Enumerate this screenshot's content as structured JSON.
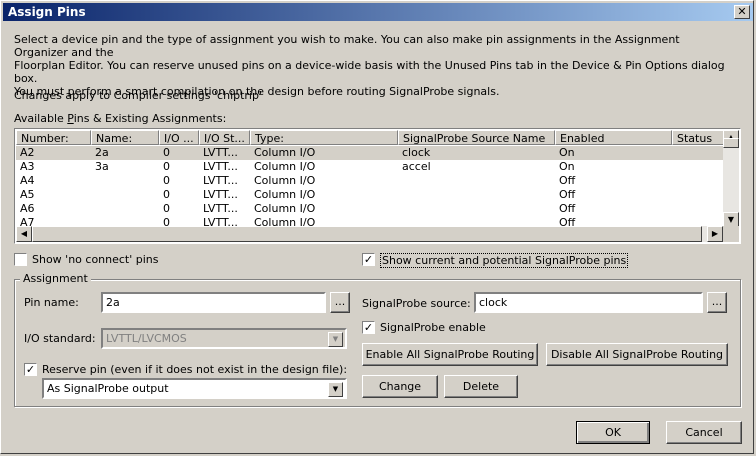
{
  "window": {
    "title": "Assign Pins",
    "close_glyph": "✕"
  },
  "intro": {
    "line1": "Select a device pin and the type of assignment you wish to make.  You can also make pin assignments in the Assignment Organizer and the",
    "line2": "Floorplan Editor.  You can reserve unused pins on a device-wide basis with the Unused Pins tab in the Device & Pin Options dialog box.",
    "line3": "You must perform a smart compilation on the design before routing SignalProbe signals."
  },
  "compiler_note": "Changes apply to Compiler settings 'chiptrip'",
  "list": {
    "label_pre": "Available ",
    "label_u": "P",
    "label_post": "ins & Existing Assignments:",
    "columns": [
      "Number:",
      "Name:",
      "I/O ...",
      "I/O St...",
      "Type:",
      "SignalProbe Source Name",
      "Enabled",
      "Status"
    ],
    "rows": [
      [
        "A2",
        "2a",
        "0",
        "LVTT...",
        "Column I/O",
        "clock",
        "On",
        ""
      ],
      [
        "A3",
        "3a",
        "0",
        "LVTT...",
        "Column I/O",
        "accel",
        "On",
        ""
      ],
      [
        "A4",
        "",
        "0",
        "LVTT...",
        "Column I/O",
        "",
        "Off",
        ""
      ],
      [
        "A5",
        "",
        "0",
        "LVTT...",
        "Column I/O",
        "",
        "Off",
        ""
      ],
      [
        "A6",
        "",
        "0",
        "LVTT...",
        "Column I/O",
        "",
        "Off",
        ""
      ],
      [
        "A7",
        "",
        "0",
        "LVTT...",
        "Column I/O",
        "",
        "Off",
        ""
      ]
    ],
    "selected_row": 0
  },
  "options": {
    "no_connect": {
      "label": "Show 'no connect' pins",
      "checked": false
    },
    "signalprobe_pins": {
      "label": "Show current and potential SignalProbe pins",
      "checked": true
    }
  },
  "assignment": {
    "group_label": "Assignment",
    "pin_name_label": "Pin name:",
    "pin_name_value": "2a",
    "browse_label": "...",
    "io_standard_label": "I/O standard:",
    "io_standard_value": "LVTTL/LVCMOS",
    "reserve_label": "Reserve pin (even if it does not exist in the design file):",
    "reserve_checked": true,
    "reserve_value": "As SignalProbe output",
    "sp_source_label": "SignalProbe source:",
    "sp_source_value": "clock",
    "sp_enable_label": "SignalProbe enable",
    "sp_enable_checked": true,
    "enable_all_label": "Enable All SignalProbe Routing",
    "disable_all_label": "Disable All SignalProbe Routing",
    "change_label": "Change",
    "delete_label": "Delete"
  },
  "footer": {
    "ok_label": "OK",
    "cancel_label": "Cancel"
  }
}
